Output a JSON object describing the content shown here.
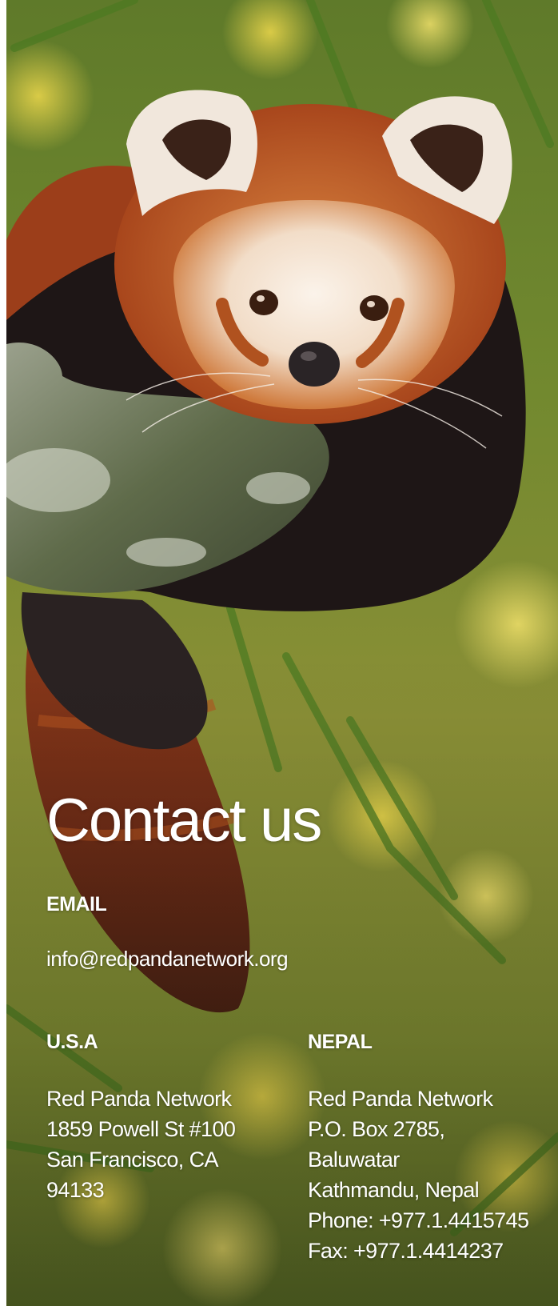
{
  "hero": {
    "image_subject": "red-panda-photo"
  },
  "contact": {
    "title": "Contact us",
    "email_label": "EMAIL",
    "email_value": "info@redpandanetwork.org"
  },
  "offices": {
    "usa": {
      "label": "U.S.A",
      "lines": [
        "Red Panda Network",
        "1859 Powell St #100",
        "San Francisco, CA",
        "94133"
      ]
    },
    "nepal": {
      "label": "NEPAL",
      "lines": [
        "Red Panda Network",
        "P.O. Box 2785,",
        "Baluwatar",
        "Kathmandu, Nepal",
        "Phone: +977.1.4415745",
        "Fax: +977.1.4414237"
      ]
    }
  },
  "colors": {
    "text": "#ffffff",
    "fur": "#c8602a",
    "background_foliage": "#6f8a2c"
  }
}
